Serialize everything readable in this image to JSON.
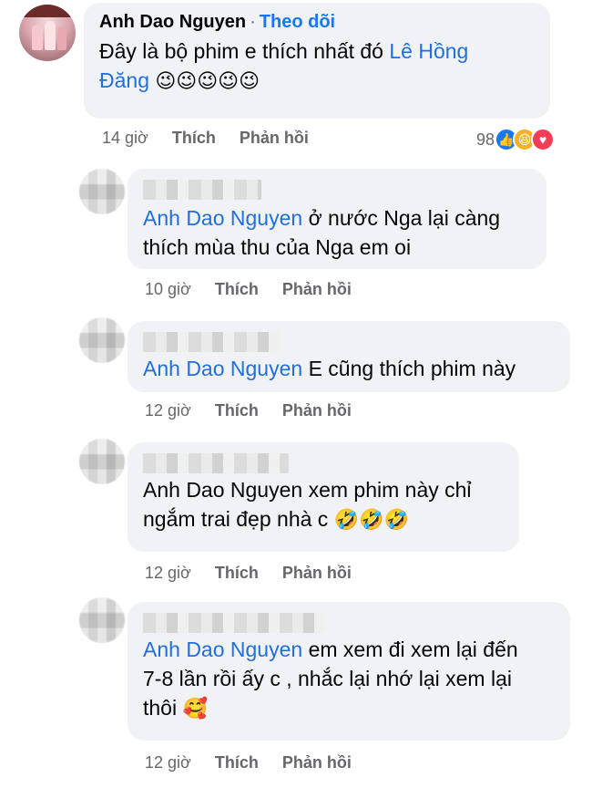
{
  "main_comment": {
    "author": "Anh Dao Nguyen",
    "separator": "·",
    "follow_label": "Theo dõi",
    "text_prefix": "Đây là bộ phim e thích nhất đó ",
    "tag_first": "Lê Hồng",
    "tag_second": "Đăng",
    "emojis": "😉😉😉😉😉",
    "time": "14 giờ",
    "like_label": "Thích",
    "reply_label": "Phản hồi",
    "reaction_count": "98",
    "reaction_icons": [
      "like-icon",
      "haha-icon",
      "love-icon"
    ]
  },
  "replies": [
    {
      "tag": "Anh Dao Nguyen",
      "text_line1": " ở nước Nga lại càng",
      "text_line2": "thích mùa thu của Nga em oi",
      "time": "10 giờ",
      "like_label": "Thích",
      "reply_label": "Phản hồi"
    },
    {
      "tag": "Anh Dao Nguyen",
      "text_line1": " E cũng thích phim này",
      "time": "12 giờ",
      "like_label": "Thích",
      "reply_label": "Phản hồi"
    },
    {
      "text_line1": "Anh Dao Nguyen xem phim này chỉ",
      "text_line2": "ngắm trai đẹp nhà c ",
      "emojis": "🤣🤣🤣",
      "time": "12 giờ",
      "like_label": "Thích",
      "reply_label": "Phản hồi"
    },
    {
      "tag": "Anh Dao Nguyen",
      "text_line1": " em xem đi xem lại đến",
      "text_line2": "7-8 lần rồi ấy c , nhắc lại nhớ lại xem lại",
      "text_line3": "thôi ",
      "emojis": "🥰",
      "time": "12 giờ",
      "like_label": "Thích",
      "reply_label": "Phản hồi"
    }
  ],
  "colors": {
    "bubble": "#f0f2f5",
    "link": "#1877f2",
    "meta": "#65676b"
  }
}
